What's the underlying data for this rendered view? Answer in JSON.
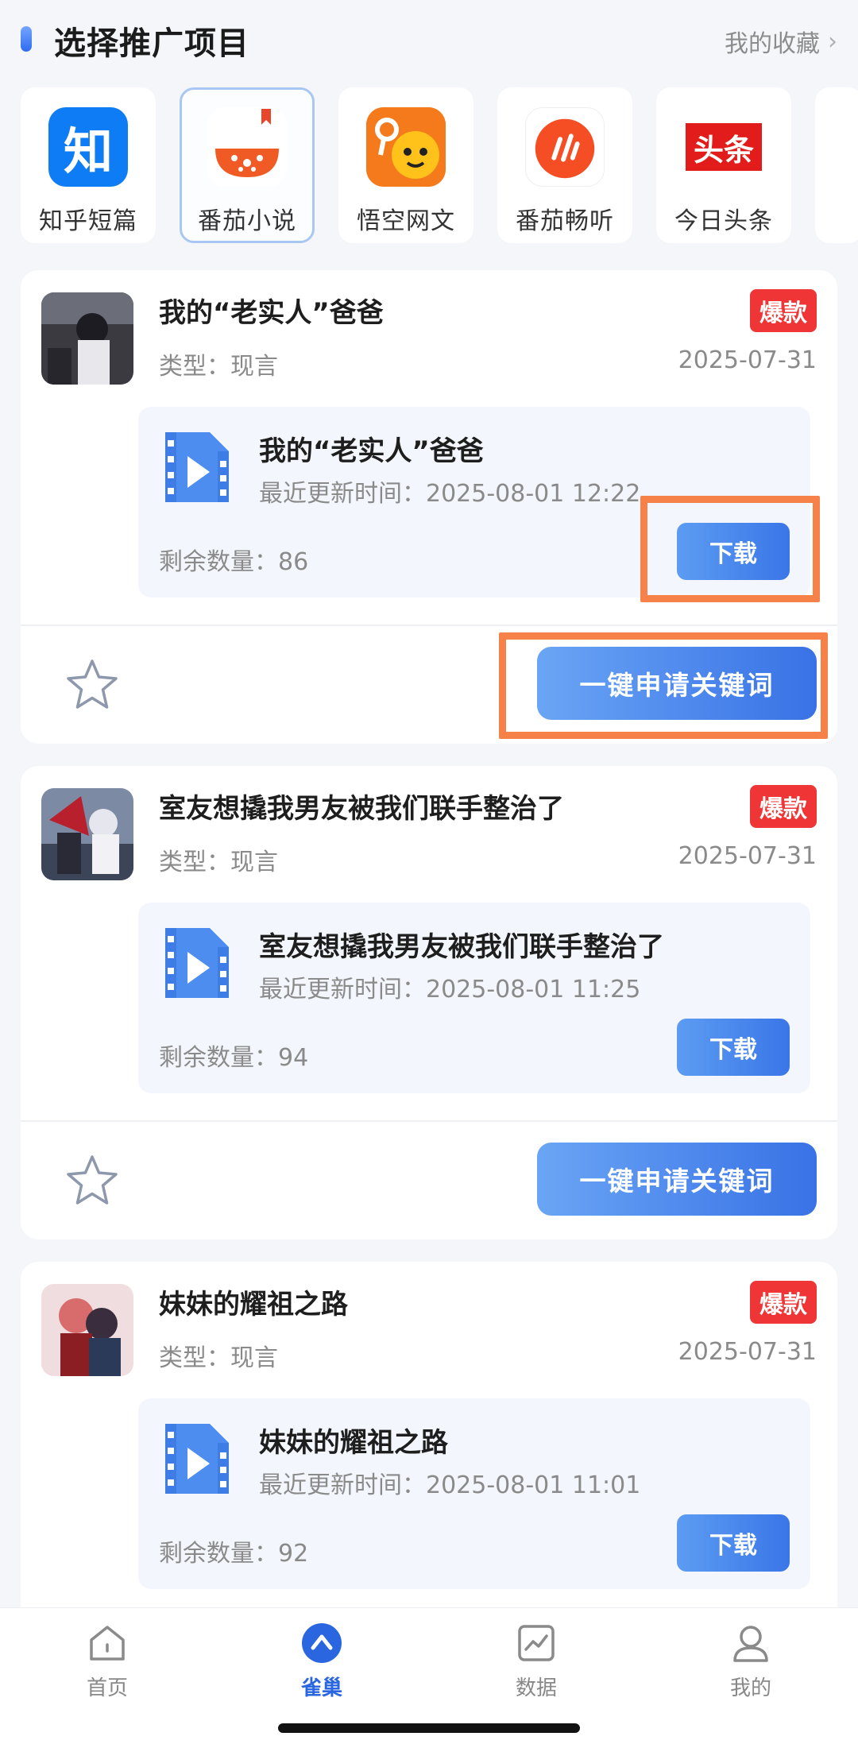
{
  "header": {
    "title": "选择推广项目",
    "favorites_label": "我的收藏",
    "chevron": "›"
  },
  "projects": [
    {
      "label": "知乎短篇",
      "icon": "zhihu-logo-icon",
      "glyph": "知",
      "color": "#0e7cf5"
    },
    {
      "label": "番茄小说",
      "icon": "fanqie-novel-logo-icon",
      "color": "#f05a24"
    },
    {
      "label": "悟空网文",
      "icon": "wukong-logo-icon",
      "color": "#f7a120"
    },
    {
      "label": "番茄畅听",
      "icon": "fanqie-listen-logo-icon",
      "color": "#f54d24"
    },
    {
      "label": "今日头条",
      "icon": "toutiao-logo-icon",
      "glyph": "头条",
      "color": "#e21b1b"
    }
  ],
  "cards": [
    {
      "title": "我的“老实人”爸爸",
      "badge": "爆款",
      "type": "类型：现言",
      "date": "2025-07-31",
      "episode_title": "我的“老实人”爸爸",
      "updated": "最近更新时间：2025-08-01 12:22",
      "remaining": "剩余数量：86",
      "download_label": "下载",
      "apply_label": "一键申请关键词"
    },
    {
      "title": "室友想撬我男友被我们联手整治了",
      "badge": "爆款",
      "type": "类型：现言",
      "date": "2025-07-31",
      "episode_title": "室友想撬我男友被我们联手整治了",
      "updated": "最近更新时间：2025-08-01 11:25",
      "remaining": "剩余数量：94",
      "download_label": "下载",
      "apply_label": "一键申请关键词"
    },
    {
      "title": "妹妹的耀祖之路",
      "badge": "爆款",
      "type": "类型：现言",
      "date": "2025-07-31",
      "episode_title": "妹妹的耀祖之路",
      "updated": "最近更新时间：2025-08-01 11:01",
      "remaining": "剩余数量：92",
      "download_label": "下载"
    }
  ],
  "bottom_nav": [
    {
      "label": "首页",
      "icon": "home-icon"
    },
    {
      "label": "雀巢",
      "icon": "nest-icon",
      "active": true
    },
    {
      "label": "数据",
      "icon": "chart-icon"
    },
    {
      "label": "我的",
      "icon": "profile-icon"
    }
  ],
  "colors": {
    "accent": "#3a76e8",
    "hot_badge": "#ef3535",
    "highlight": "#f6824a"
  }
}
